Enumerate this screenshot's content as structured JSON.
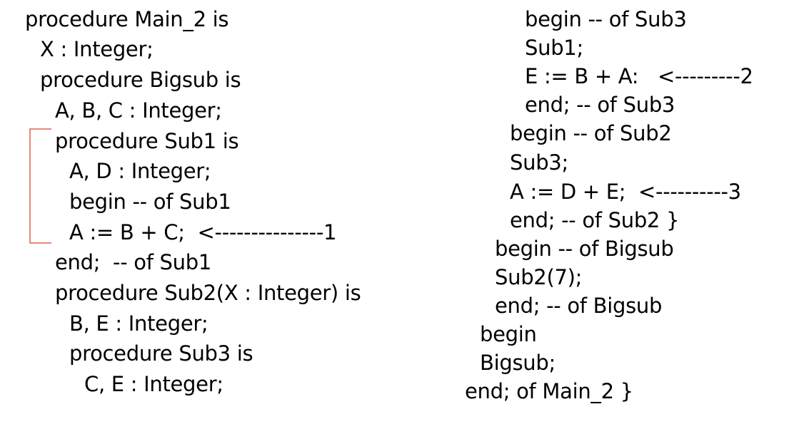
{
  "left_column": [
    "procedure Main_2 is",
    "X : Integer;",
    "procedure Bigsub is",
    "A, B, C : Integer;",
    "procedure Sub1 is",
    "A, D : Integer;",
    "begin -- of Sub1",
    "A := B + C;  <---------------1",
    "end;  -- of Sub1",
    "procedure Sub2(X : Integer) is",
    "B, E : Integer;",
    "procedure Sub3 is",
    "C, E : Integer;"
  ],
  "right_column": [
    "begin -- of Sub3",
    "Sub1;",
    "E := B + A:   <---------2",
    "end; -- of Sub3",
    "begin -- of Sub2",
    "Sub3;",
    "A := D + E;  <----------3",
    "end; -- of Sub2 }",
    "begin -- of Bigsub",
    "Sub2(7);",
    "end; -- of Bigsub",
    "begin",
    "Bigsub;",
    "end; of Main_2 }"
  ],
  "colors": {
    "text": "#000000",
    "bracket": "#e06050",
    "background": "#ffffff"
  }
}
